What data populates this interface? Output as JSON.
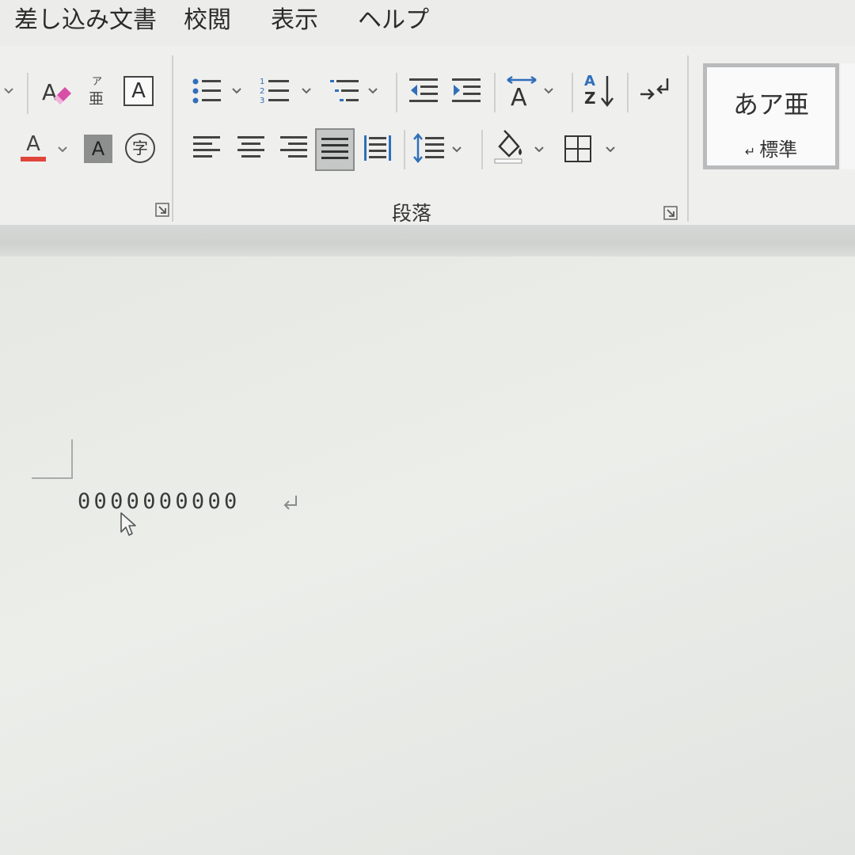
{
  "menu": {
    "tabs": [
      "差し込み文書",
      "校閲",
      "表示",
      "ヘルプ"
    ]
  },
  "ribbon": {
    "font_group": {
      "phonetic_guide_top": "ア",
      "phonetic_guide_bottom": "亜",
      "char_border_letter": "A",
      "font_color_letter": "A",
      "char_shading_letter": "A",
      "enclose_char": "字",
      "font_color": "#e0453a"
    },
    "paragraph_group": {
      "label": "段落",
      "sort_top": "A",
      "sort_bottom": "Z"
    },
    "styles": {
      "sample_text": "あア亜",
      "style_name": "標準"
    }
  },
  "document": {
    "line_text": "0000000000",
    "paragraph_mark": "↵"
  },
  "colors": {
    "accent_blue": "#2f6fba",
    "selected_fill": "#c5c6c6",
    "icon_gray": "#444444"
  }
}
